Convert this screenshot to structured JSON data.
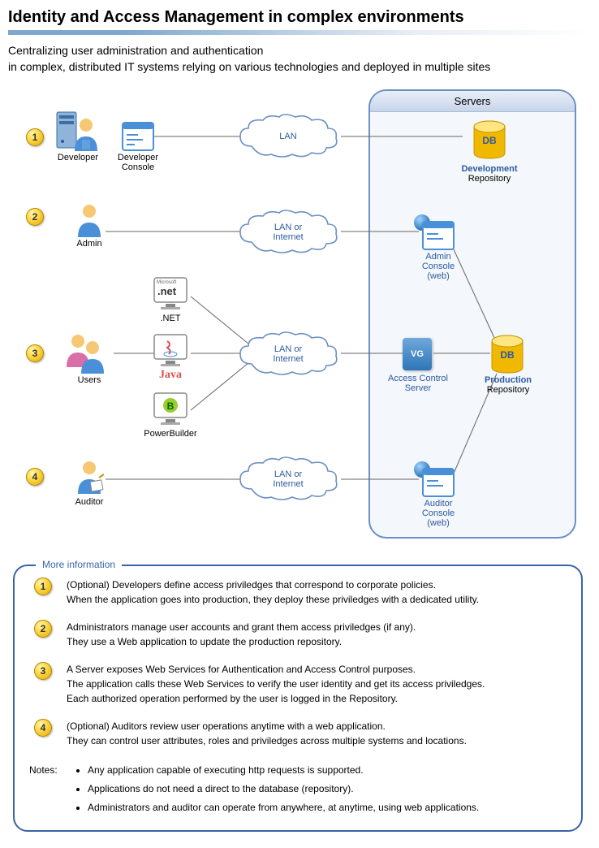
{
  "title": "Identity and Access Management in complex environments",
  "subtitle_line1": "Centralizing user administration and authentication",
  "subtitle_line2": "in complex, distributed IT systems relying on various technologies and deployed in multiple sites",
  "servers_header": "Servers",
  "rows": {
    "r1": {
      "num": "1",
      "actor": "Developer",
      "console": "Developer\nConsole",
      "cloud": "LAN",
      "db_label": "DB",
      "db_title": "Development",
      "db_sub": "Repository"
    },
    "r2": {
      "num": "2",
      "actor": "Admin",
      "cloud": "LAN or\nInternet",
      "console_title": "Admin\nConsole\n(web)"
    },
    "r3": {
      "num": "3",
      "actor": "Users",
      "cloud": "LAN or\nInternet",
      "tech_net": ".NET",
      "tech_java": "Java",
      "tech_pb": "PowerBuilder",
      "acs": "VG",
      "acs_label": "Access Control\nServer",
      "db_label": "DB",
      "db_title": "Production",
      "db_sub": "Repository"
    },
    "r4": {
      "num": "4",
      "actor": "Auditor",
      "cloud": "LAN or\nInternet",
      "console_title": "Auditor\nConsole\n(web)"
    }
  },
  "info_header": "More information",
  "info_items": [
    {
      "num": "1",
      "line1": "(Optional) Developers define access priviledges that correspond to corporate policies.",
      "line2": "When the application goes into production, they deploy these priviledges with a dedicated utility."
    },
    {
      "num": "2",
      "line1": "Administrators manage user accounts and grant them access priviledges (if any).",
      "line2": "They use a Web application to update the production repository."
    },
    {
      "num": "3",
      "line1": "A Server exposes Web Services for Authentication and Access Control purposes.",
      "line2": "The application calls these Web Services to verify the user identity and get its access priviledges.",
      "line3": "Each authorized operation performed by the user is logged in the Repository."
    },
    {
      "num": "4",
      "line1": "(Optional) Auditors review user operations anytime with a web application.",
      "line2": "They can control user attributes, roles and priviledges across multiple systems and locations."
    }
  ],
  "notes_label": "Notes:",
  "notes": [
    "Any application capable of executing http requests is supported.",
    "Applications do not need a direct to the database (repository).",
    "Administrators and auditor can operate from anywhere, at anytime, using web applications."
  ],
  "net_icon_text": ".net",
  "net_icon_prefix": "Microsoft"
}
